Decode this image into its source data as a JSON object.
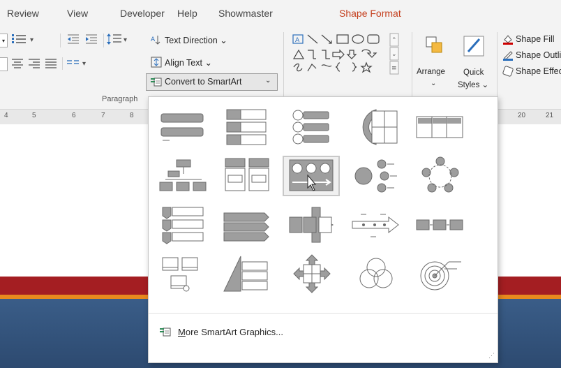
{
  "tabs": [
    {
      "label": "Review"
    },
    {
      "label": "View"
    },
    {
      "label": "Developer"
    },
    {
      "label": "Help"
    },
    {
      "label": "Showmaster"
    },
    {
      "label": "Shape Format",
      "active": true
    }
  ],
  "ribbon": {
    "text_direction": "Text Direction",
    "align_text": "Align Text",
    "convert_smartart": "Convert to SmartArt",
    "paragraph_group": "Paragraph",
    "arrange": "Arrange",
    "quick_styles_1": "Quick",
    "quick_styles_2": "Styles",
    "shape_fill": "Shape Fill",
    "shape_outline": "Shape Outline",
    "shape_effects": "Shape Effects"
  },
  "ruler": {
    "left_ticks": [
      "4",
      "5",
      "6",
      "7",
      "8"
    ],
    "right_ticks": [
      "20",
      "21"
    ]
  },
  "smartart_menu": {
    "layouts": [
      {
        "icon": "basic-block-list-icon"
      },
      {
        "icon": "vertical-bullet-list-icon"
      },
      {
        "icon": "vertical-circle-list-icon"
      },
      {
        "icon": "half-circle-list-icon"
      },
      {
        "icon": "horizontal-bullet-list-icon"
      },
      {
        "icon": "organization-chart-icon"
      },
      {
        "icon": "table-list-icon"
      },
      {
        "icon": "picture-accent-process-icon",
        "selected": true
      },
      {
        "icon": "radial-list-icon"
      },
      {
        "icon": "cycle-icon"
      },
      {
        "icon": "vertical-chevron-list-icon"
      },
      {
        "icon": "segmented-arrow-list-icon"
      },
      {
        "icon": "process-arrow-icon"
      },
      {
        "icon": "timeline-arrow-icon"
      },
      {
        "icon": "basic-process-icon"
      },
      {
        "icon": "picture-caption-list-icon"
      },
      {
        "icon": "pyramid-list-icon"
      },
      {
        "icon": "matrix-arrows-icon"
      },
      {
        "icon": "venn-diagram-icon"
      },
      {
        "icon": "target-icon"
      }
    ],
    "more_label": "More SmartArt Graphics...",
    "more_hotkey": "M"
  },
  "colors": {
    "accent": "#c43e1c",
    "slide_red": "#a41e22",
    "slide_blue": "#2d4a70"
  }
}
